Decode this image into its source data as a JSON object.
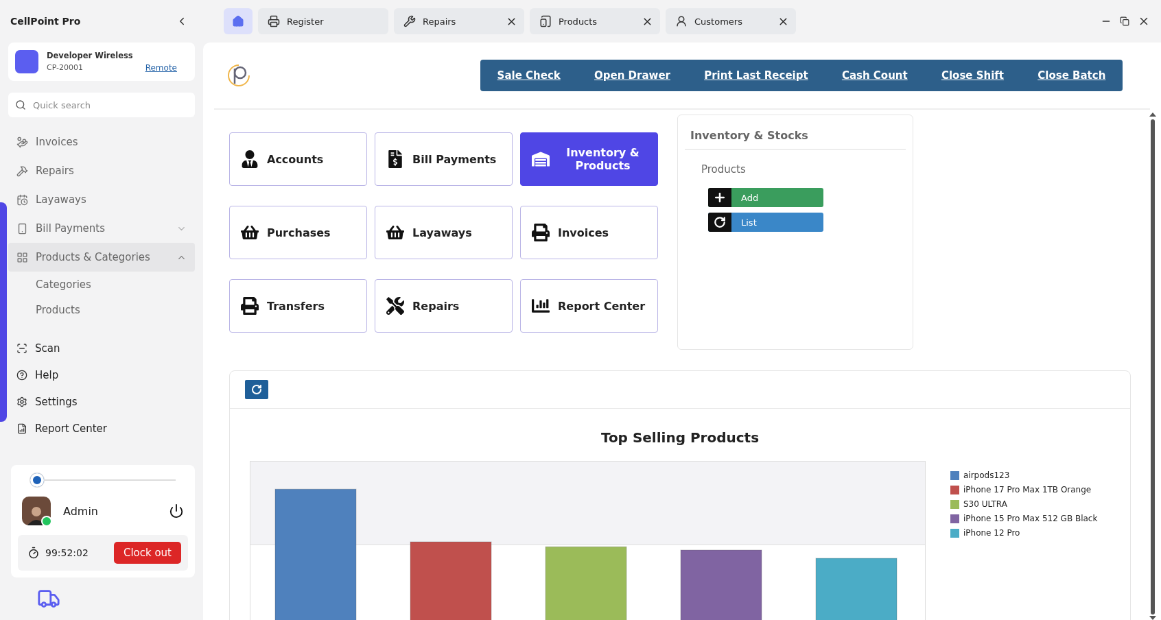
{
  "app": {
    "title": "CellPoint Pro"
  },
  "account": {
    "name": "Developer Wireless",
    "code": "CP-20001",
    "link": "Remote"
  },
  "search": {
    "placeholder": "Quick search"
  },
  "nav": [
    {
      "label": "Invoices",
      "selected": false
    },
    {
      "label": "Repairs",
      "selected": false
    },
    {
      "label": "Layaways",
      "selected": false
    },
    {
      "label": "Bill Payments",
      "selected": false,
      "expanded": false
    },
    {
      "label": "Products & Categories",
      "selected": true,
      "expanded": true,
      "children": [
        {
          "label": "Categories",
          "selected": false
        },
        {
          "label": "Products",
          "selected": false
        }
      ]
    }
  ],
  "nav_bottom": [
    {
      "label": "Scan"
    },
    {
      "label": "Help"
    },
    {
      "label": "Settings"
    },
    {
      "label": "Report Center"
    }
  ],
  "user": {
    "name": "Admin",
    "online": true,
    "level": 0,
    "timer": "99:52:02",
    "button": "Clock out"
  },
  "tabs": [
    {
      "kind": "home",
      "selected": true,
      "closable": false
    },
    {
      "kind": "page",
      "label": "Register",
      "selected": false,
      "closable": false
    },
    {
      "kind": "page",
      "label": "Repairs",
      "selected": false,
      "closable": true
    },
    {
      "kind": "page",
      "label": "Products",
      "selected": false,
      "closable": true
    },
    {
      "kind": "page",
      "label": "Customers",
      "selected": false,
      "closable": true
    }
  ],
  "actions": [
    "Sale Check",
    "Open Drawer",
    "Print Last Receipt",
    "Cash Count",
    "Close Shift",
    "Close Batch"
  ],
  "tiles": [
    {
      "label": "Accounts",
      "selected": false
    },
    {
      "label": "Bill Payments",
      "selected": false
    },
    {
      "label": "Inventory & Products",
      "selected": true
    },
    {
      "label": "Purchases",
      "selected": false
    },
    {
      "label": "Layaways",
      "selected": false
    },
    {
      "label": "Invoices",
      "selected": false
    },
    {
      "label": "Transfers",
      "selected": false
    },
    {
      "label": "Repairs",
      "selected": false
    },
    {
      "label": "Report Center",
      "selected": false
    }
  ],
  "panel": {
    "title": "Inventory & Stocks",
    "section": "Products",
    "buttons": [
      {
        "kind": "add",
        "label": "Add"
      },
      {
        "kind": "list",
        "label": "List"
      }
    ]
  },
  "chart": {
    "title": "Top Selling Products",
    "legend": [
      {
        "label": "airpods123",
        "color": "#4f81bd"
      },
      {
        "label": "iPhone 17 Pro Max 1TB Orange",
        "color": "#c0504d"
      },
      {
        "label": "S30 ULTRA",
        "color": "#9bbb59"
      },
      {
        "label": "iPhone 15 Pro Max 512 GB Black",
        "color": "#8064a2"
      },
      {
        "label": "iPhone 12 Pro",
        "color": "#4bacc6"
      }
    ]
  }
}
